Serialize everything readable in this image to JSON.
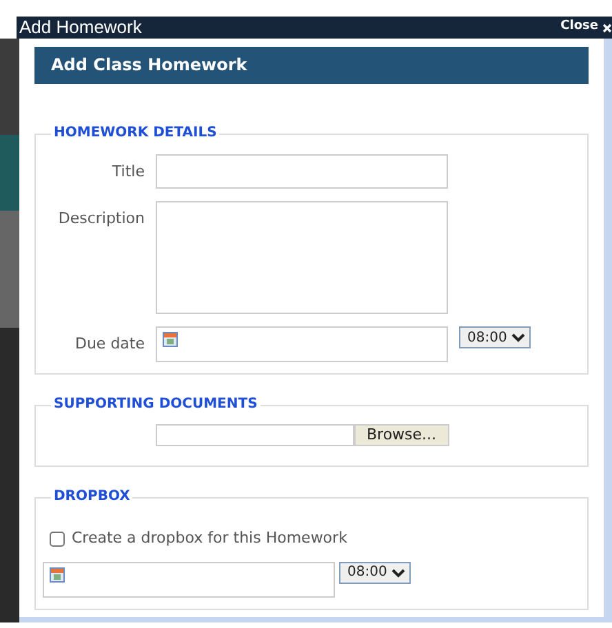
{
  "window": {
    "title": "Add Homework",
    "close_label": "Close"
  },
  "header": "Add Class Homework",
  "sections": [
    {
      "kind": "details",
      "legend": "HOMEWORK DETAILS",
      "fields": [
        {
          "kind": "text",
          "label": "Title"
        },
        {
          "kind": "textarea",
          "label": "Description"
        },
        {
          "kind": "datetime",
          "label": "Due date",
          "time": "08:00"
        }
      ]
    },
    {
      "kind": "upload",
      "legend": "SUPPORTING DOCUMENTS",
      "button": "Browse..."
    },
    {
      "kind": "dropbox",
      "legend": "DROPBOX",
      "checkbox": {
        "label": "Create a dropbox for this Homework",
        "checked": false
      },
      "time": "08:00"
    }
  ]
}
